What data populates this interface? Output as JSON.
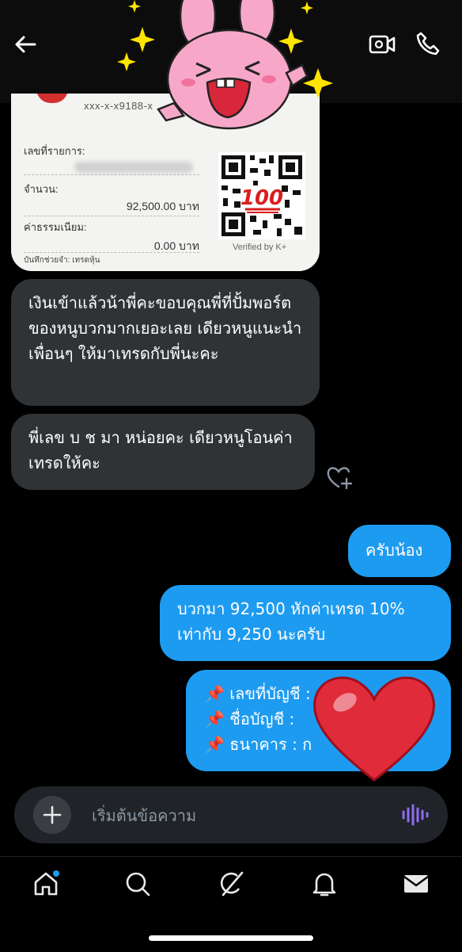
{
  "slip": {
    "account_masked": "xxx-x-x9188-x",
    "ref_label": "เลขที่รายการ:",
    "amount_label": "จำนวน:",
    "amount_value": "92,500.00 บาท",
    "fee_label": "ค่าธรรมเนียม:",
    "fee_value": "0.00 บาท",
    "memo": "บันทึกช่วยจำ: เทรดหุ้น",
    "verified": "Verified by K+"
  },
  "messages": [
    {
      "side": "in",
      "text": "เงินเข้าแล้วน้าพี่คะขอบคุณพี่ที่ปั้มพอร์ตของหนูบวกมากเยอะเลย เดียวหนูแนะนำเพื่อนๆ ให้มาเทรดกับพี่นะคะ"
    },
    {
      "side": "in",
      "text": "พี่เลข บ ช มา หน่อยคะ เดียวหนูโอนค่าเทรดให้คะ"
    },
    {
      "side": "out",
      "text": "ครับน้อง"
    },
    {
      "side": "out",
      "text": "บวกมา 92,500 หักค่าเทรด 10% เท่ากับ 9,250 นะครับ"
    },
    {
      "side": "out",
      "lines": [
        "📌 เลขที่บัญชี :",
        "📌 ชื่อบัญชี :",
        "📌 ธนาคาร : ก"
      ]
    }
  ],
  "composer": {
    "placeholder": "เริ่มต้นข้อความ"
  },
  "nav": [
    "home",
    "search",
    "grok",
    "notifications",
    "messages"
  ],
  "colors": {
    "accent": "#1d9bf0",
    "incoming": "#2f3336"
  }
}
